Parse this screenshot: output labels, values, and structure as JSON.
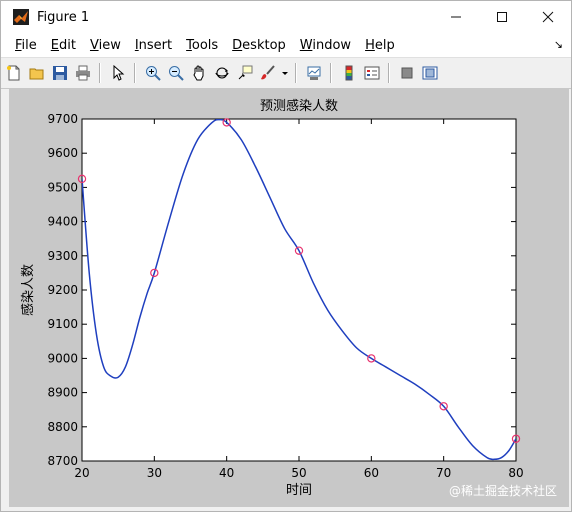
{
  "window": {
    "title": "Figure 1",
    "controls": [
      "minimize",
      "maximize",
      "close"
    ]
  },
  "menu": {
    "items": [
      {
        "accel": "F",
        "rest": "ile"
      },
      {
        "accel": "E",
        "rest": "dit"
      },
      {
        "accel": "V",
        "rest": "iew"
      },
      {
        "accel": "I",
        "rest": "nsert"
      },
      {
        "accel": "T",
        "rest": "ools"
      },
      {
        "accel": "D",
        "rest": "esktop"
      },
      {
        "accel": "W",
        "rest": "indow"
      },
      {
        "accel": "H",
        "rest": "elp"
      }
    ],
    "dock_arrow": "↘"
  },
  "toolbar": {
    "icons": [
      "new-figure-icon",
      "open-file-icon",
      "save-icon",
      "print-icon",
      "pointer-icon",
      "zoom-in-icon",
      "zoom-out-icon",
      "pan-hand-icon",
      "rotate-3d-icon",
      "data-cursor-icon",
      "brush-icon",
      "link-plot-icon",
      "colorbar-icon",
      "legend-icon",
      "hide-plot-tools-icon",
      "show-plot-tools-icon"
    ]
  },
  "chart_data": {
    "type": "line",
    "title": "预测感染人数",
    "xlabel": "时间",
    "ylabel": "感染人数",
    "xlim": [
      20,
      80
    ],
    "ylim": [
      8700,
      9700
    ],
    "xticks": [
      20,
      30,
      40,
      50,
      60,
      70,
      80
    ],
    "yticks": [
      8700,
      8800,
      8900,
      9000,
      9100,
      9200,
      9300,
      9400,
      9500,
      9600,
      9700
    ],
    "grid": false,
    "series": [
      {
        "kind": "markers",
        "marker": "circle",
        "color": "#e8326e",
        "x": [
          20,
          30,
          40,
          50,
          60,
          70,
          80
        ],
        "y": [
          9525,
          9250,
          9690,
          9315,
          9000,
          8860,
          8765
        ]
      },
      {
        "kind": "curve",
        "color": "#1f3fbf",
        "x": [
          20,
          21,
          22,
          23,
          24,
          25,
          26,
          27,
          28,
          29,
          30,
          32,
          34,
          36,
          38,
          39,
          40,
          42,
          44,
          46,
          48,
          50,
          52,
          54,
          56,
          58,
          60,
          62,
          64,
          66,
          68,
          70,
          72,
          74,
          76,
          77,
          78,
          79,
          80
        ],
        "y": [
          9525,
          9250,
          9070,
          8975,
          8948,
          8945,
          8975,
          9040,
          9120,
          9190,
          9250,
          9400,
          9540,
          9640,
          9690,
          9698,
          9690,
          9640,
          9560,
          9470,
          9380,
          9315,
          9220,
          9140,
          9080,
          9030,
          9000,
          8975,
          8950,
          8925,
          8895,
          8860,
          8800,
          8745,
          8710,
          8705,
          8710,
          8730,
          8765
        ]
      }
    ]
  },
  "watermark": "@稀土掘金技术社区"
}
